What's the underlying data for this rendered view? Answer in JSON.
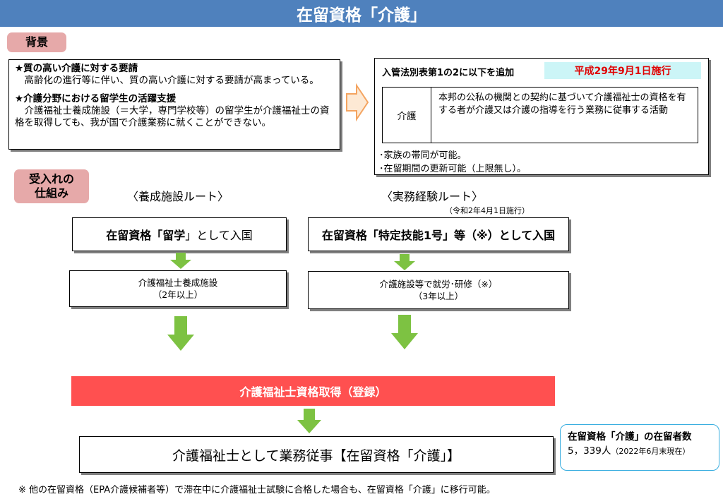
{
  "title": "在留資格「介護」",
  "background": {
    "label": "背景",
    "heading1": "★質の高い介護に対する要請",
    "text1": "高齢化の進行等に伴い、質の高い介護に対する要請が高まっている。",
    "heading2": "★介護分野における留学生の活躍支援",
    "text2": "介護福祉士養成施設（＝大学，専門学校等）の留学生が介護福祉士の資格を取得しても、我が国で介護業務に就くことができない。"
  },
  "law": {
    "heading": "入管法別表第1の2に以下を追加",
    "effective": "平成29年9月1日施行",
    "table_label": "介護",
    "table_text": "本邦の公私の機関との契約に基づいて介護福祉士の資格を有する者が介護又は介護の指導を行う業務に従事する活動",
    "note1": "･家族の帯同が可能。",
    "note2": "･在留期間の更新可能（上限無し）。"
  },
  "acceptance": {
    "label_line1": "受入れの",
    "label_line2": "仕組み",
    "route1": {
      "title": "〈養成施設ルート〉",
      "step1_a": "在留資格「",
      "step1_b": "留学",
      "step1_c": "」として入国",
      "step2_line1": "介護福祉士養成施設",
      "step2_line2": "（2年以上）"
    },
    "route2": {
      "title": "〈実務経験ルート〉",
      "subtitle": "（令和2年4月1日施行）",
      "step1_a": "在留資格「",
      "step1_b": "特定技能1号",
      "step1_c": "」等（※）として入国",
      "step2_line1": "介護施設等で就労･研修（※）",
      "step2_line2": "（3年以上）"
    },
    "qualification": "介護福祉士資格取得（登録）",
    "result": "介護福祉士として業務従事【在留資格「介護」】"
  },
  "residents": {
    "heading": "在留資格「介護」の在留者数",
    "count": "5，339人",
    "note": "（2022年6月末現在）"
  },
  "footnote": "※ 他の在留資格（EPA介護候補者等）で滞在中に介護福祉士試験に合格した場合も、在留資格「介護」に移行可能。",
  "colors": {
    "title_bar": "#4f81bd",
    "tag": "#e6a9a9",
    "arrow_green": "#7dc242",
    "qualification_red": "#ff5050",
    "effective_bg": "#ccf5f7",
    "residents_border": "#3aaee0",
    "hollow_arrow": "#f4a460"
  }
}
